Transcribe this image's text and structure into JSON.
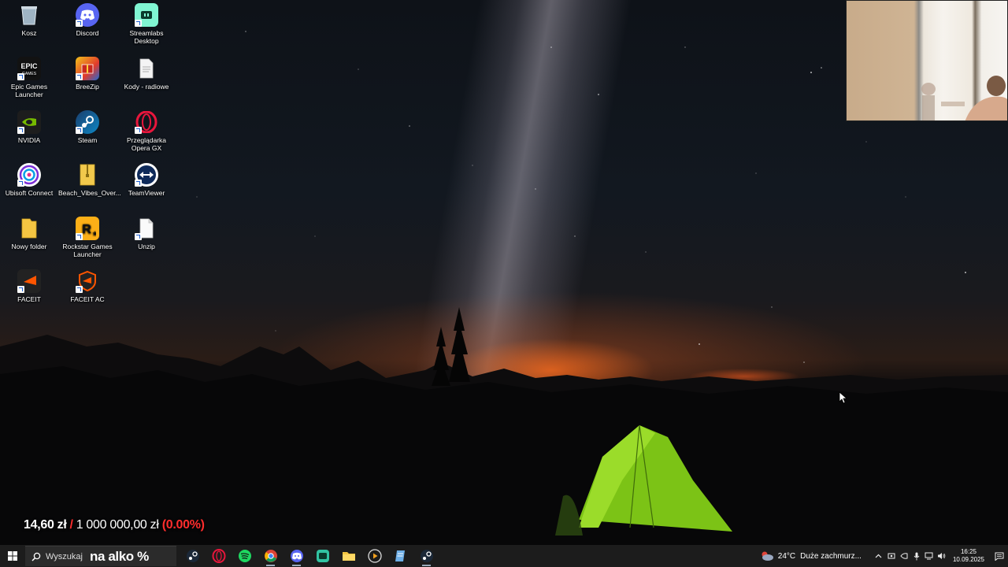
{
  "desktop": {
    "icons": [
      {
        "label": "Kosz",
        "icon": "recycle-bin-icon"
      },
      {
        "label": "Discord",
        "icon": "discord-icon"
      },
      {
        "label": "Streamlabs Desktop",
        "icon": "streamlabs-icon"
      },
      {
        "label": "Epic Games Launcher",
        "icon": "epic-games-icon"
      },
      {
        "label": "BreeZip",
        "icon": "breezip-icon"
      },
      {
        "label": "Kody - radiowe",
        "icon": "text-file-icon"
      },
      {
        "label": "NVIDIA",
        "icon": "nvidia-icon"
      },
      {
        "label": "Steam",
        "icon": "steam-icon"
      },
      {
        "label": "Przeglądarka Opera GX",
        "icon": "opera-gx-icon"
      },
      {
        "label": "Ubisoft Connect",
        "icon": "ubisoft-icon"
      },
      {
        "label": "Beach_Vibes_Over...",
        "icon": "zip-folder-icon"
      },
      {
        "label": "TeamViewer",
        "icon": "teamviewer-icon"
      },
      {
        "label": "Nowy folder",
        "icon": "folder-icon"
      },
      {
        "label": "Rockstar Games Launcher",
        "icon": "rockstar-icon"
      },
      {
        "label": "Unzip",
        "icon": "file-icon"
      },
      {
        "label": "FACEIT",
        "icon": "faceit-icon"
      },
      {
        "label": "FACEIT AC",
        "icon": "faceit-ac-icon"
      }
    ]
  },
  "overlay": {
    "amount": "14,60 zł",
    "separator": "/",
    "goal": "1 000 000,00 zł",
    "percent": "(0.00%)",
    "search_caption": "na alko %"
  },
  "taskbar": {
    "search_placeholder": "Wyszukaj",
    "apps": [
      "steam-icon",
      "opera-gx-icon",
      "spotify-icon",
      "chrome-icon",
      "discord-icon",
      "streamlabs-icon",
      "file-explorer-icon",
      "media-player-icon",
      "notepad-icon",
      "steam-icon"
    ],
    "weather": {
      "temperature": "24°C",
      "condition": "Duże zachmurz..."
    },
    "clock": {
      "time": "16:25",
      "date": "10.09.2025"
    }
  },
  "colors": {
    "accent_red": "#ff2d2d",
    "taskbar_bg": "#1c1c1c",
    "tent_green": "#8bd11a"
  }
}
